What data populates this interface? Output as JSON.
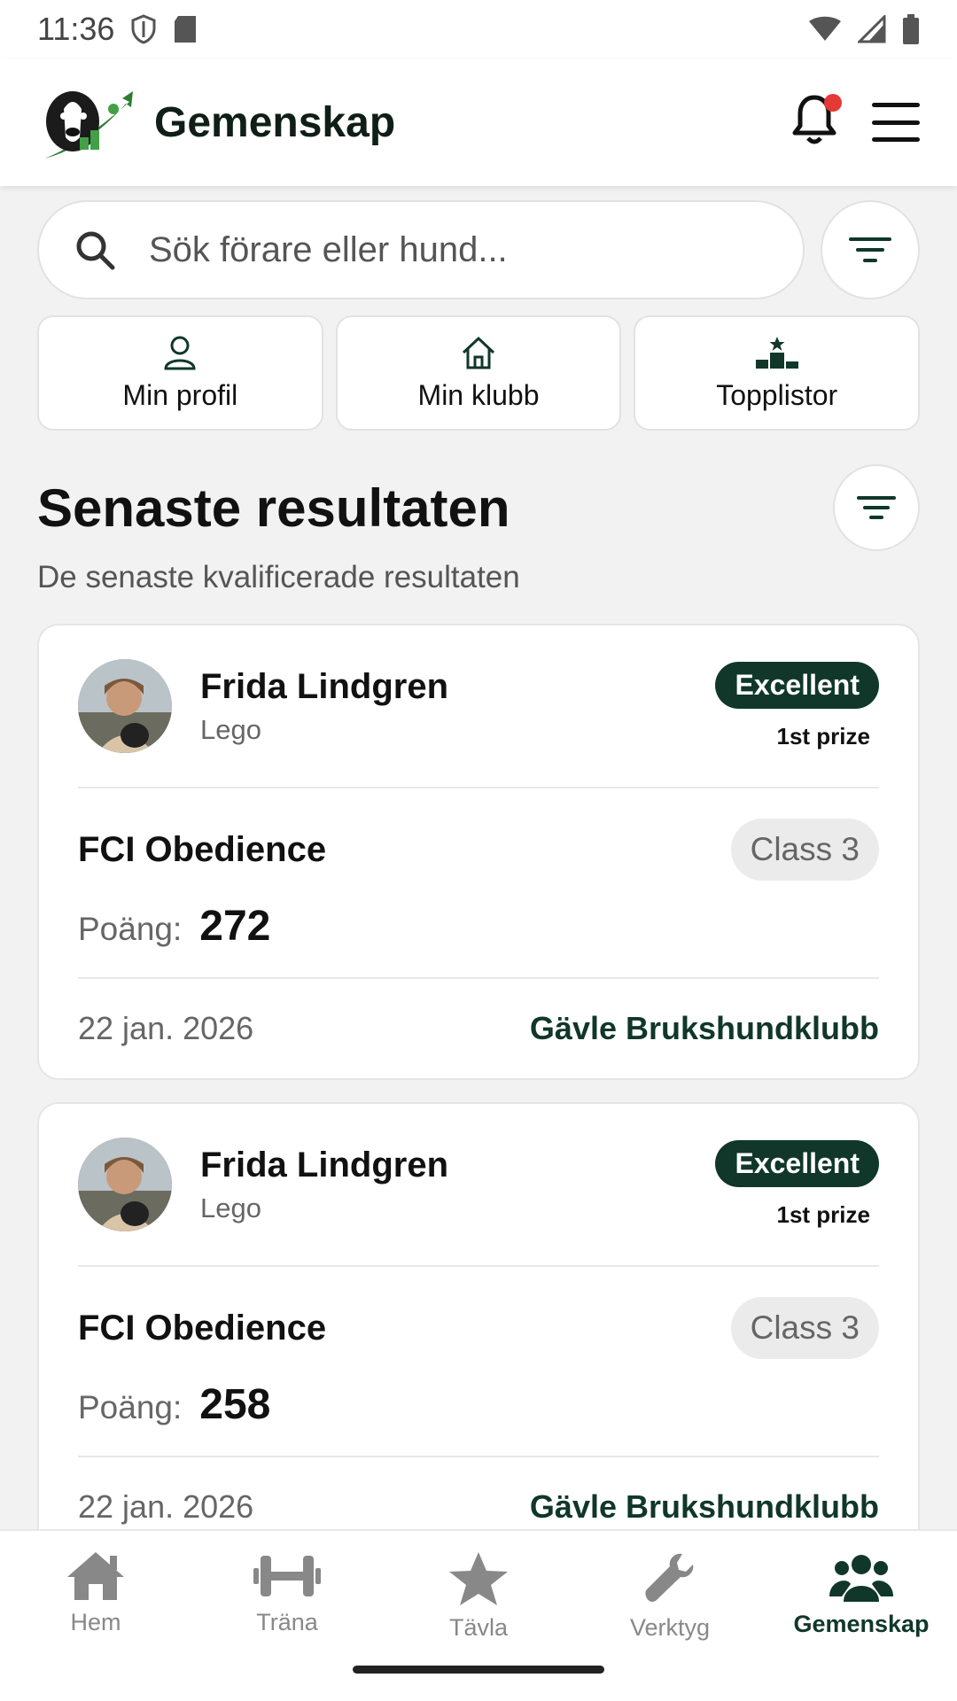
{
  "status": {
    "time": "11:36"
  },
  "app": {
    "title": "Gemenskap"
  },
  "search": {
    "placeholder": "Sök förare eller hund..."
  },
  "quick_links": [
    {
      "label": "Min profil",
      "icon": "person-icon"
    },
    {
      "label": "Min klubb",
      "icon": "home-outline-icon"
    },
    {
      "label": "Topplistor",
      "icon": "podium-icon"
    }
  ],
  "section": {
    "title": "Senaste resultaten",
    "subtitle": "De senaste kvalificerade resultaten"
  },
  "results": [
    {
      "person": "Frida Lindgren",
      "dog": "Lego",
      "level": "Excellent",
      "prize": "1st prize",
      "event": "FCI Obedience",
      "class": "Class 3",
      "score_label": "Poäng:",
      "score": "272",
      "date": "22 jan. 2026",
      "club": "Gävle Brukshundklubb"
    },
    {
      "person": "Frida Lindgren",
      "dog": "Lego",
      "level": "Excellent",
      "prize": "1st prize",
      "event": "FCI Obedience",
      "class": "Class 3",
      "score_label": "Poäng:",
      "score": "258",
      "date": "22 jan. 2026",
      "club": "Gävle Brukshundklubb"
    }
  ],
  "nav": [
    {
      "label": "Hem",
      "icon": "home-icon",
      "active": false
    },
    {
      "label": "Träna",
      "icon": "dumbbell-icon",
      "active": false
    },
    {
      "label": "Tävla",
      "icon": "star-icon",
      "active": false
    },
    {
      "label": "Verktyg",
      "icon": "wrench-icon",
      "active": false
    },
    {
      "label": "Gemenskap",
      "icon": "people-icon",
      "active": true
    }
  ],
  "colors": {
    "brand": "#10372a",
    "notification": "#e53935"
  }
}
